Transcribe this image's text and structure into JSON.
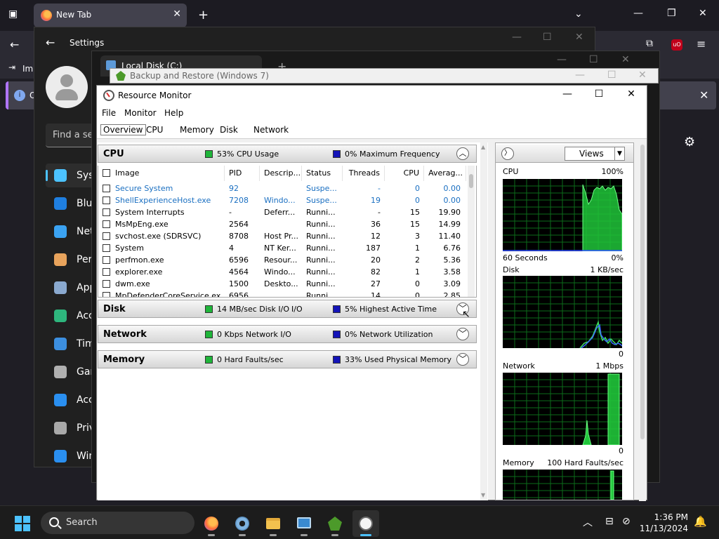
{
  "browser": {
    "tab_title": "New Tab",
    "bookmark_label": "Imp",
    "notice_text": "O"
  },
  "settings": {
    "title": "Settings",
    "search_placeholder": "Find a se",
    "nav": [
      {
        "label": "Syst",
        "color": "#4cc2ff"
      },
      {
        "label": "Blue",
        "color": "#1f7fe0"
      },
      {
        "label": "Net",
        "color": "#3ba3f2"
      },
      {
        "label": "Pers",
        "color": "#e8a35c"
      },
      {
        "label": "App",
        "color": "#8aa9cf"
      },
      {
        "label": "Acc",
        "color": "#2eb67d"
      },
      {
        "label": "Tim",
        "color": "#3c8fe0"
      },
      {
        "label": "Gar",
        "color": "#b0b0b0"
      },
      {
        "label": "Acc",
        "color": "#2a8ff0"
      },
      {
        "label": "Priv",
        "color": "#a9a9a9"
      },
      {
        "label": "Win",
        "color": "#2a8ff0"
      }
    ]
  },
  "localdisk": {
    "tab_title": "Local Disk (C:)"
  },
  "backup": {
    "title": "Backup and Restore (Windows 7)"
  },
  "rm": {
    "title": "Resource Monitor",
    "menu": [
      "File",
      "Monitor",
      "Help"
    ],
    "tabs": [
      "Overview",
      "CPU",
      "Memory",
      "Disk",
      "Network"
    ],
    "cpu": {
      "name": "CPU",
      "usage": "53% CPU Usage",
      "freq": "0% Maximum Frequency",
      "usage_color": "#1fb53a",
      "freq_color": "#1414b8"
    },
    "columns": [
      "Image",
      "PID",
      "Descrip...",
      "Status",
      "Threads",
      "CPU",
      "Averag..."
    ],
    "rows": [
      {
        "image": "Secure System",
        "pid": "92",
        "desc": "",
        "status": "Suspe...",
        "threads": "-",
        "cpu": "0",
        "avg": "0.00",
        "suspended": true
      },
      {
        "image": "ShellExperienceHost.exe",
        "pid": "7208",
        "desc": "Windo...",
        "status": "Suspe...",
        "threads": "19",
        "cpu": "0",
        "avg": "0.00",
        "suspended": true
      },
      {
        "image": "System Interrupts",
        "pid": "-",
        "desc": "Deferr...",
        "status": "Runni...",
        "threads": "-",
        "cpu": "15",
        "avg": "19.90",
        "suspended": false
      },
      {
        "image": "MsMpEng.exe",
        "pid": "2564",
        "desc": "",
        "status": "Runni...",
        "threads": "36",
        "cpu": "15",
        "avg": "14.99",
        "suspended": false
      },
      {
        "image": "svchost.exe (SDRSVC)",
        "pid": "8708",
        "desc": "Host Pr...",
        "status": "Runni...",
        "threads": "12",
        "cpu": "3",
        "avg": "11.40",
        "suspended": false
      },
      {
        "image": "System",
        "pid": "4",
        "desc": "NT Ker...",
        "status": "Runni...",
        "threads": "187",
        "cpu": "1",
        "avg": "6.76",
        "suspended": false
      },
      {
        "image": "perfmon.exe",
        "pid": "6596",
        "desc": "Resour...",
        "status": "Runni...",
        "threads": "20",
        "cpu": "2",
        "avg": "5.36",
        "suspended": false
      },
      {
        "image": "explorer.exe",
        "pid": "4564",
        "desc": "Windo...",
        "status": "Runni...",
        "threads": "82",
        "cpu": "1",
        "avg": "3.58",
        "suspended": false
      },
      {
        "image": "dwm.exe",
        "pid": "1500",
        "desc": "Deskto...",
        "status": "Runni...",
        "threads": "27",
        "cpu": "0",
        "avg": "3.09",
        "suspended": false
      },
      {
        "image": "MpDefenderCoreService.exe",
        "pid": "6956",
        "desc": "",
        "status": "Runni...",
        "threads": "14",
        "cpu": "0",
        "avg": "2.85",
        "suspended": false
      }
    ],
    "disk": {
      "name": "Disk",
      "io": "14 MB/sec Disk I/O",
      "io_extra": "I/O",
      "active": "5% Highest Active Time"
    },
    "network": {
      "name": "Network",
      "io": "0 Kbps Network I/O",
      "util": "0% Network Utilization"
    },
    "memory": {
      "name": "Memory",
      "faults": "0 Hard Faults/sec",
      "used": "33% Used Physical Memory"
    },
    "right": {
      "views_label": "Views",
      "cpu_label": "CPU",
      "cpu_max": "100%",
      "cpu_time": "60 Seconds",
      "cpu_min": "0%",
      "disk_label": "Disk",
      "disk_max": "1 KB/sec",
      "disk_min": "0",
      "net_label": "Network",
      "net_max": "1 Mbps",
      "net_min": "0",
      "mem_label": "Memory",
      "mem_max": "100 Hard Faults/sec"
    }
  },
  "taskbar": {
    "search_label": "Search",
    "time": "1:36 PM",
    "date": "11/13/2024",
    "accent": "#4cc2ff"
  }
}
